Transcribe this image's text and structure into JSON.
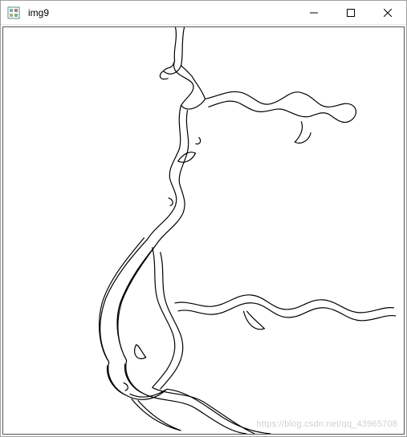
{
  "window": {
    "title": "img9"
  },
  "controls": {
    "minimize_aria": "Minimize",
    "maximize_aria": "Maximize",
    "close_aria": "Close"
  },
  "watermark": "https://blog.csdn.net/qq_43965708",
  "image": {
    "description": "Edge-detected vascular angiogram (black outlines on white)",
    "stroke_color": "#000000",
    "background": "#ffffff"
  }
}
